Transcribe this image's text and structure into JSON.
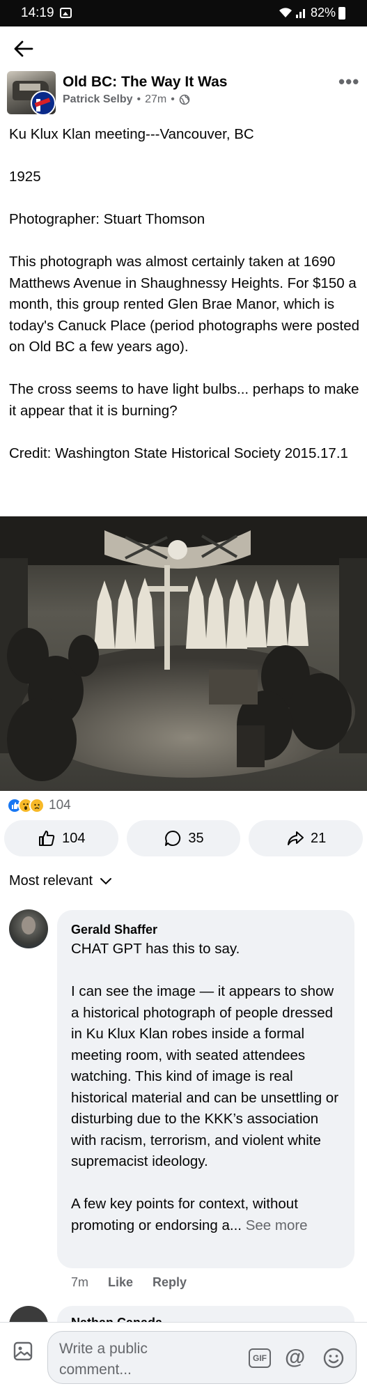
{
  "status_bar": {
    "time": "14:19",
    "battery": "82%"
  },
  "post": {
    "group_name": "Old BC: The Way It Was",
    "author": "Patrick Selby",
    "separator": "•",
    "time_ago": "27m",
    "paragraphs": [
      "Ku Klux Klan meeting---Vancouver, BC",
      "1925",
      "Photographer: Stuart Thomson",
      "This photograph was almost certainly taken at 1690 Matthews Avenue in Shaughnessy Heights. For $150 a month, this group rented Glen Brae Manor, which is today's Canuck Place (period photographs were posted on Old BC a few years ago).",
      "The cross seems to have light bulbs... perhaps to make it appear that it is burning?",
      "Credit:  Washington State Historical Society 2015.17.1"
    ]
  },
  "reactions": {
    "total": "104",
    "types": [
      "like",
      "wow",
      "sad"
    ]
  },
  "actions": {
    "like_count": "104",
    "comment_count": "35",
    "share_count": "21"
  },
  "comments_sort": "Most relevant",
  "comment": {
    "author": "Gerald Shaffer",
    "paragraphs": [
      "CHAT GPT has this to say.",
      "I can see the image — it appears to show a historical photograph of people dressed in Ku Klux Klan robes inside a formal meeting room, with seated attendees watching. This kind of image is real historical material and can be unsettling or disturbing due to the KKK’s association with racism, terrorism, and violent white supremacist ideology."
    ],
    "truncated_text": "A few key points for context, without promoting or endorsing a...",
    "see_more": "See more",
    "time_ago": "7m",
    "like_label": "Like",
    "reply_label": "Reply"
  },
  "next_comment": {
    "author": "Nathan Canada"
  },
  "composer": {
    "placeholder": "Write a public comment...",
    "gif_label": "GIF",
    "mention_label": "@"
  },
  "colors": {
    "facebook_blue": "#1877f2",
    "secondary_text": "#65676b",
    "bubble_bg": "#f0f2f5"
  }
}
